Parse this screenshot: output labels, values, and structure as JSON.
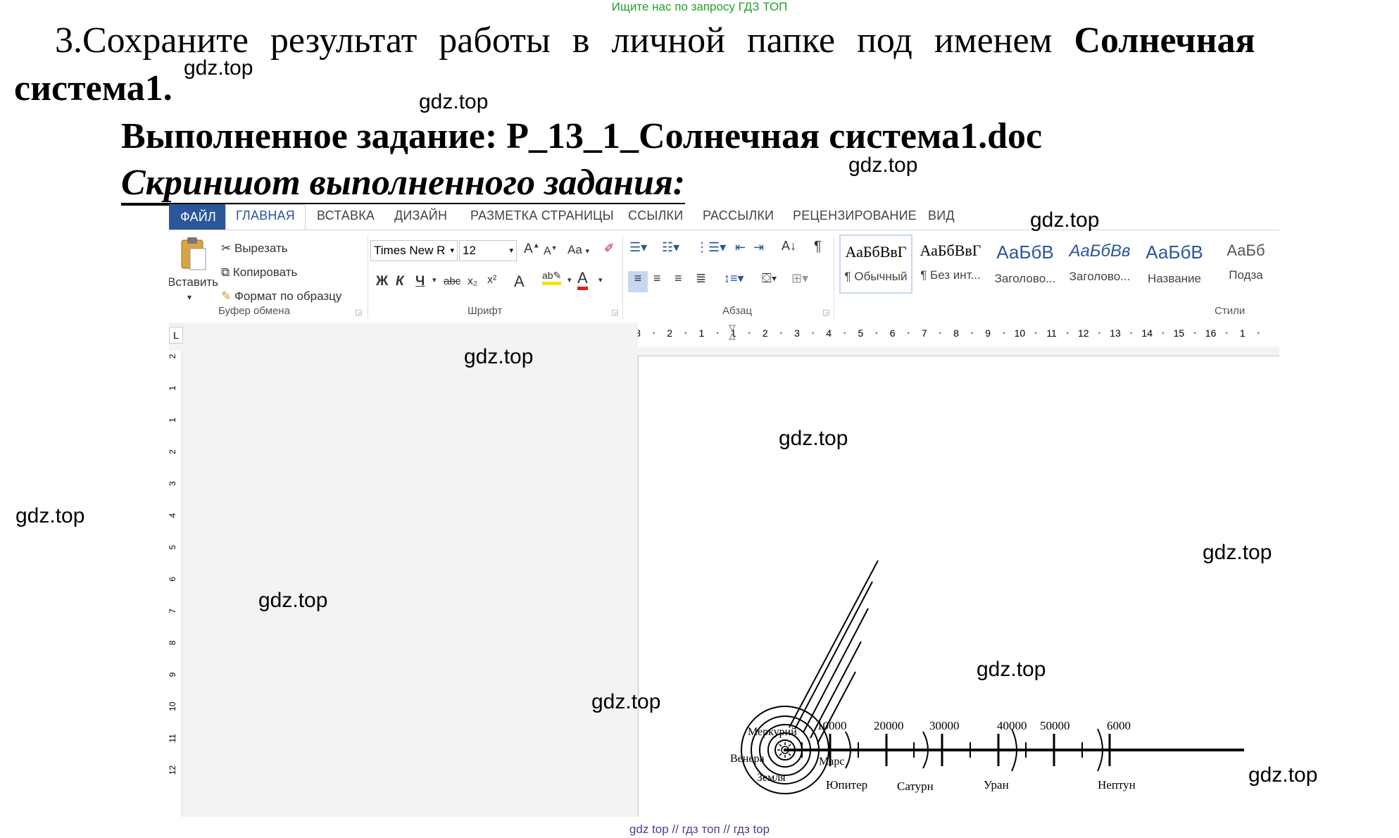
{
  "header_note": "Ищите нас по запросу ГДЗ ТОП",
  "task": {
    "line1_prefix": "3.Сохраните результат работы в личной папке под именем ",
    "line1_bold": "Солнечная",
    "line2_bold": "система1."
  },
  "done_label": "Выполненное задание: P_13_1_Солнечная система1.doc",
  "screenshot_label": "Скриншот выполненного задания:",
  "watermarks": [
    "gdz.top",
    "gdz.top",
    "gdz.top",
    "gdz.top",
    "gdz.top",
    "gdz.top",
    "gdz.top",
    "gdz.top",
    "gdz.top",
    "gdz.top",
    "gdz.top",
    "gdz.top"
  ],
  "footer_note": "gdz top // гдз топ // гдз top",
  "word": {
    "tabs": [
      "ФАЙЛ",
      "ГЛАВНАЯ",
      "ВСТАВКА",
      "ДИЗАЙН",
      "РАЗМЕТКА СТРАНИЦЫ",
      "ССЫЛКИ",
      "РАССЫЛКИ",
      "РЕЦЕНЗИРОВАНИЕ",
      "ВИД"
    ],
    "clipboard": {
      "paste": "Вставить",
      "cut": "Вырезать",
      "copy": "Копировать",
      "format_painter": "Формат по образцу",
      "group": "Буфер обмена"
    },
    "font": {
      "name": "Times New R",
      "size": "12",
      "group": "Шрифт",
      "bold": "Ж",
      "italic": "К",
      "underline": "Ч",
      "strike": "abc",
      "sub": "x₂",
      "sup": "x²",
      "aa": "Aa",
      "grow": "A",
      "shrink": "A"
    },
    "paragraph": {
      "group": "Абзац",
      "pilcrow": "¶"
    },
    "styles": {
      "group": "Стили",
      "items": [
        {
          "sample": "АаБбВвГ",
          "name": "¶ Обычный"
        },
        {
          "sample": "АаБбВвГ",
          "name": "¶ Без инт..."
        },
        {
          "sample": "АаБбВ",
          "name": "Заголово..."
        },
        {
          "sample": "АаБбВв",
          "name": "Заголово..."
        },
        {
          "sample": "АаБбВ",
          "name": "Название"
        },
        {
          "sample": "АаБб",
          "name": "Подза"
        }
      ]
    },
    "ruler_h": [
      "3",
      "2",
      "1",
      "1",
      "2",
      "3",
      "4",
      "5",
      "6",
      "7",
      "8",
      "9",
      "10",
      "11",
      "12",
      "13",
      "14",
      "15",
      "16",
      "1"
    ],
    "ruler_v": [
      "2",
      "1",
      "1",
      "2",
      "3",
      "4",
      "5",
      "6",
      "7",
      "8",
      "9",
      "10",
      "11",
      "12"
    ],
    "ruler_corner": "L"
  },
  "drawing": {
    "scale_labels": [
      "10000",
      "20000",
      "30000",
      "40000",
      "50000",
      "6000"
    ],
    "planets": [
      "Меркурий",
      "Венера",
      "Земля",
      "Марс",
      "Юпитер",
      "Сатурн",
      "Уран",
      "Нептун"
    ]
  }
}
